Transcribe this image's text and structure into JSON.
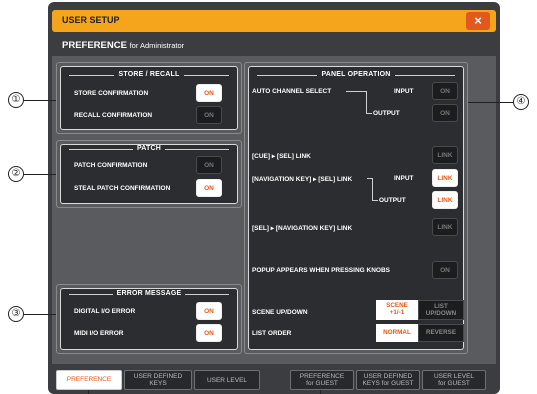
{
  "window": {
    "title": "USER SETUP",
    "close_label": "×",
    "subtitle_main": "PREFERENCE",
    "subtitle_sub": "for Administrator"
  },
  "callouts": [
    "①",
    "②",
    "③",
    "④"
  ],
  "store_recall": {
    "title": "STORE / RECALL",
    "rows": [
      {
        "label": "STORE CONFIRMATION",
        "button": "ON",
        "state": "on"
      },
      {
        "label": "RECALL CONFIRMATION",
        "button": "ON",
        "state": "off"
      }
    ]
  },
  "patch": {
    "title": "PATCH",
    "rows": [
      {
        "label": "PATCH CONFIRMATION",
        "button": "ON",
        "state": "off"
      },
      {
        "label": "STEAL PATCH CONFIRMATION",
        "button": "ON",
        "state": "on"
      }
    ]
  },
  "error_message": {
    "title": "ERROR MESSAGE",
    "rows": [
      {
        "label": "DIGITAL I/O ERROR",
        "button": "ON",
        "state": "on"
      },
      {
        "label": "MIDI I/O ERROR",
        "button": "ON",
        "state": "on"
      }
    ]
  },
  "panel_operation": {
    "title": "PANEL OPERATION",
    "auto_channel_select": {
      "label": "AUTO CHANNEL SELECT",
      "input_label": "INPUT",
      "output_label": "OUTPUT",
      "input_button": "ON",
      "output_button": "ON"
    },
    "cue_sel_link": {
      "label": "[CUE] ▸ [SEL] LINK",
      "button": "LINK"
    },
    "nav_sel_link": {
      "label": "[NAVIGATION KEY] ▸ [SEL] LINK",
      "input_label": "INPUT",
      "output_label": "OUTPUT",
      "input_button": "LINK",
      "output_button": "LINK"
    },
    "sel_nav_link": {
      "label": "[SEL] ▸ [NAVIGATION KEY] LINK",
      "button": "LINK"
    },
    "popup_knobs": {
      "label": "POPUP APPEARS WHEN PRESSING KNOBS",
      "button": "ON"
    },
    "scene_updown": {
      "label": "SCENE UP/DOWN",
      "option1_l1": "SCENE",
      "option1_l2": "+1/-1",
      "option2_l1": "LIST",
      "option2_l2": "UP/DOWN"
    },
    "list_order": {
      "label": "LIST ORDER",
      "option1": "NORMAL",
      "option2": "REVERSE"
    }
  },
  "tabs": [
    {
      "l1": "PREFERENCE",
      "l2": ""
    },
    {
      "l1": "USER DEFINED",
      "l2": "KEYS"
    },
    {
      "l1": "USER LEVEL",
      "l2": ""
    },
    {
      "l1": "PREFERENCE",
      "l2": "for GUEST"
    },
    {
      "l1": "USER DEFINED",
      "l2": "KEYS for GUEST"
    },
    {
      "l1": "USER LEVEL",
      "l2": "for GUEST"
    }
  ],
  "colors": {
    "title_bar": "#f4a51c",
    "close_button": "#e2581d",
    "on_text": "#e8581a",
    "panel_bg": "#2b2d30"
  }
}
